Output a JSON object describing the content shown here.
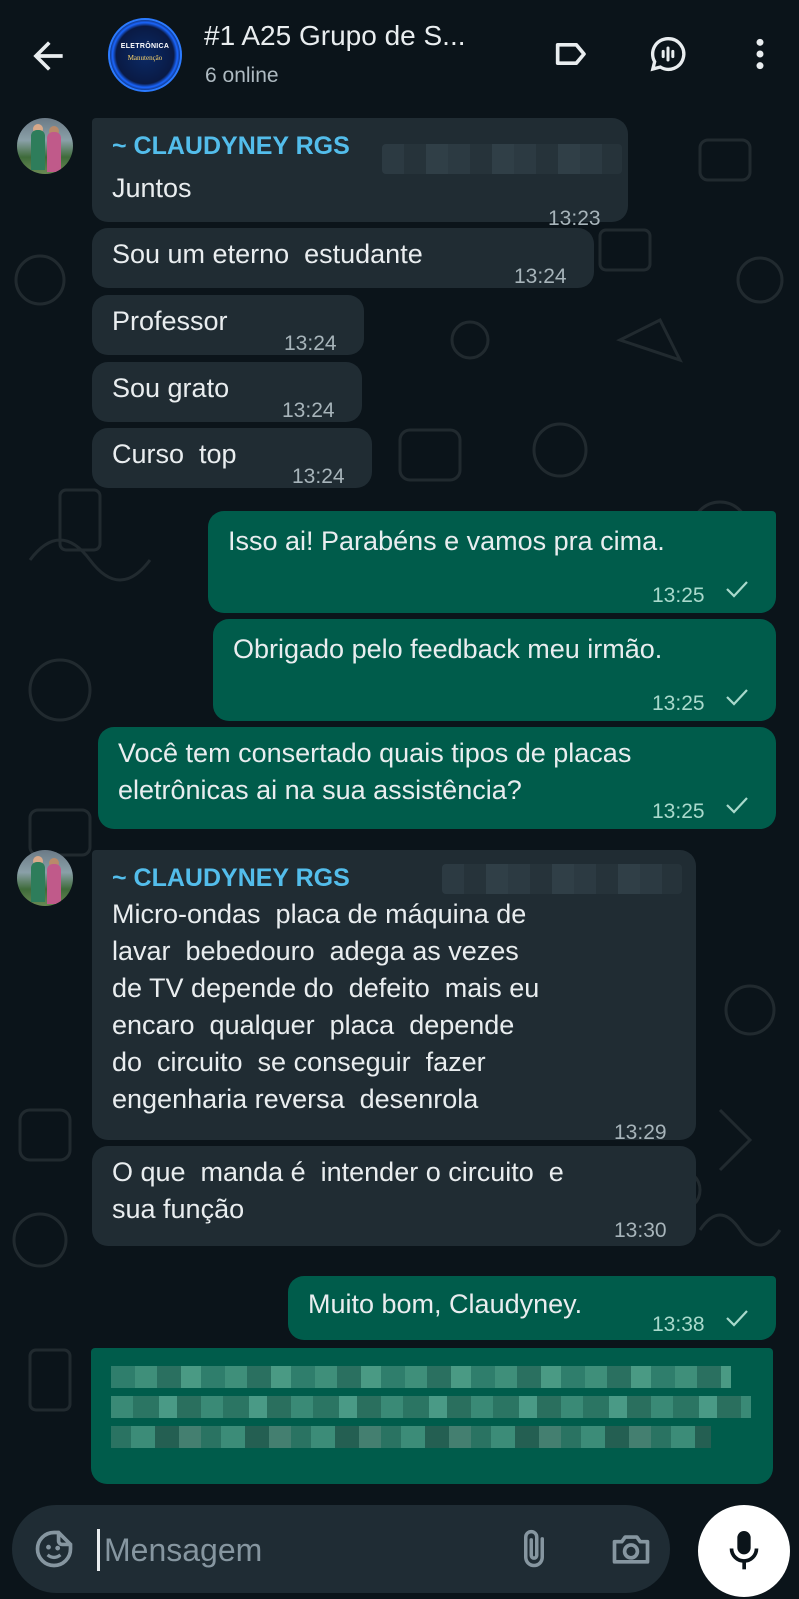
{
  "header": {
    "title": "#1 A25 Grupo de S...",
    "subtitle": "6 online",
    "avatar_line1": "ELETRÔNICA",
    "avatar_line2": "Manutenção",
    "icons": [
      "back-arrow-icon",
      "label-icon",
      "voice-chat-icon",
      "more-vert-icon"
    ]
  },
  "colors": {
    "background": "#0b141a",
    "incoming_bubble": "#202c33",
    "outgoing_bubble": "#005c4b",
    "sender_name": "#53bdeb"
  },
  "messages": [
    {
      "sender": "~ CLAUDYNEY RGS",
      "text": "Juntos",
      "time": "13:23",
      "direction": "in"
    },
    {
      "text": "Sou um eterno  estudante",
      "time": "13:24",
      "direction": "in"
    },
    {
      "text": "Professor",
      "time": "13:24",
      "direction": "in"
    },
    {
      "text": "Sou grato",
      "time": "13:24",
      "direction": "in"
    },
    {
      "text": "Curso  top",
      "time": "13:24",
      "direction": "in"
    },
    {
      "text": "Isso ai! Parabéns e vamos pra cima.",
      "time": "13:25",
      "direction": "out",
      "status": "sent"
    },
    {
      "text": "Obrigado pelo feedback meu irmão.",
      "time": "13:25",
      "direction": "out",
      "status": "sent"
    },
    {
      "text": "Você tem consertado quais tipos de placas\neletrônicas ai na sua assistência?",
      "time": "13:25",
      "direction": "out",
      "status": "sent"
    },
    {
      "sender": "~ CLAUDYNEY RGS",
      "text": "Micro-ondas  placa de máquina de\nlavar  bebedouro  adega as vezes\nde TV depende do  defeito  mais eu\nencaro  qualquer  placa  depende\ndo  circuito  se conseguir  fazer\nengenharia reversa  desenrola",
      "time": "13:29",
      "direction": "in"
    },
    {
      "text": "O que  manda é  intender o circuito  e\nsua função",
      "time": "13:30",
      "direction": "in"
    },
    {
      "text": "Muito bom, Claudyney.",
      "time": "13:38",
      "direction": "out",
      "status": "sent"
    }
  ],
  "composer": {
    "placeholder": "Mensagem",
    "icons": [
      "emoji-sticker-icon",
      "paperclip-icon",
      "camera-icon",
      "mic-icon"
    ]
  }
}
